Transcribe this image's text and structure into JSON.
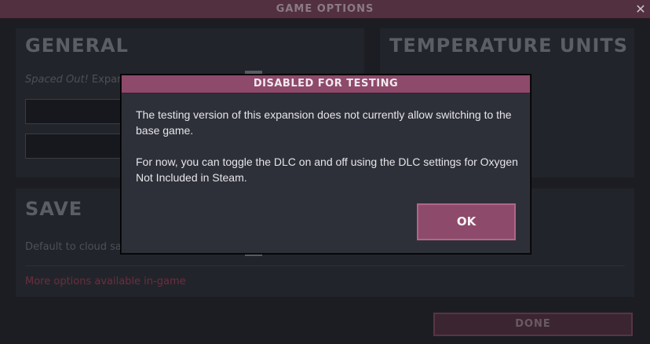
{
  "window": {
    "title": "GAME OPTIONS",
    "close_icon": "close-icon"
  },
  "general": {
    "heading": "GENERAL",
    "dlc_label_italic": "Spaced Out!",
    "dlc_label_rest": " Expan"
  },
  "temperature": {
    "heading": "TEMPERATURE UNITS"
  },
  "save": {
    "heading": "SAVE",
    "cloud_label": "Default to cloud sa",
    "more_options": "More options available in-game"
  },
  "footer": {
    "done_label": "DONE"
  },
  "dialog": {
    "title": "DISABLED FOR TESTING",
    "paragraph1": "The testing version of this expansion does not currently allow switching to the base game.",
    "paragraph2": "For now, you can toggle the DLC on and off using the DLC settings for Oxygen Not Included in Steam.",
    "ok_label": "OK"
  }
}
